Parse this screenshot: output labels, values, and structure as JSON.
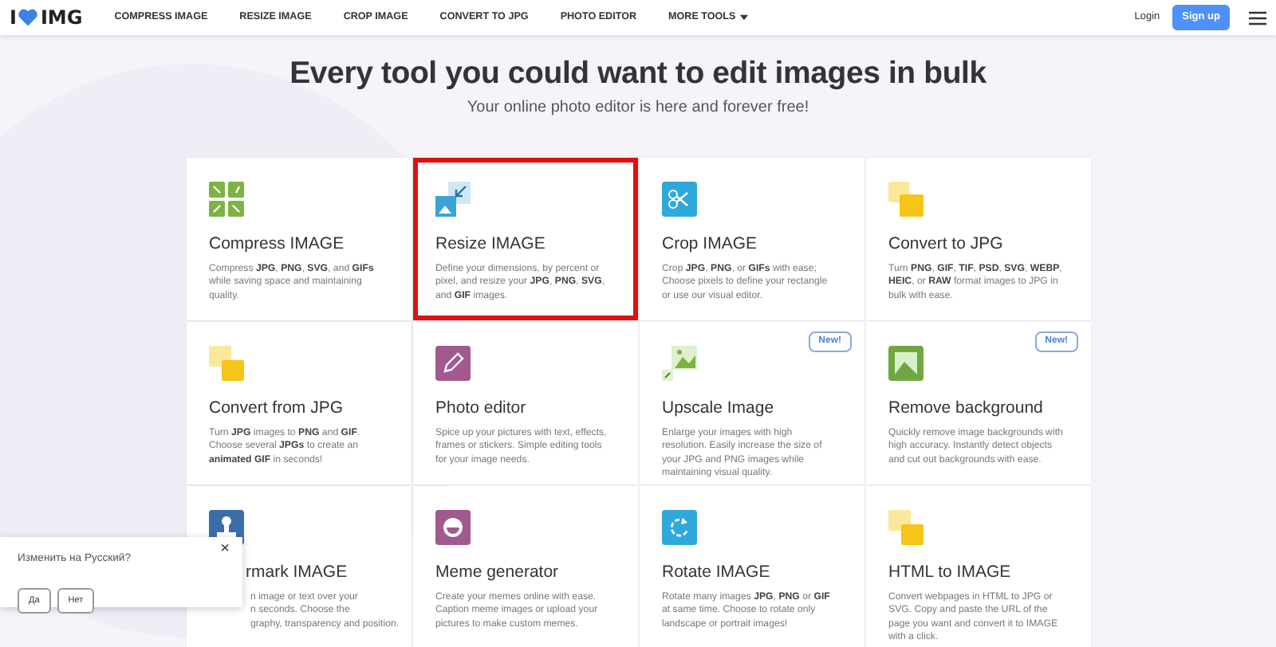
{
  "nav": {
    "logo": {
      "left": "I",
      "right": "IMG"
    },
    "links": [
      {
        "label": "COMPRESS IMAGE",
        "kind": "link"
      },
      {
        "label": "RESIZE IMAGE",
        "kind": "link"
      },
      {
        "label": "CROP IMAGE",
        "kind": "link"
      },
      {
        "label": "CONVERT TO JPG",
        "kind": "link"
      },
      {
        "label": "PHOTO EDITOR",
        "kind": "link"
      },
      {
        "label": "MORE TOOLS",
        "kind": "dropdown"
      }
    ],
    "login": "Login",
    "signup": "Sign up"
  },
  "hero": {
    "title": "Every tool you could want to edit images in bulk",
    "subtitle": "Your online photo editor is here and forever free!"
  },
  "tools": [
    {
      "title": "Compress IMAGE",
      "description": "Compress **JPG**, **PNG**, **SVG**, and **GIFs** while saving space and maintaining quality.",
      "selected": false
    },
    {
      "title": "Resize IMAGE",
      "description": "Define your dimensions, by percent or pixel, and resize your **JPG**, **PNG**, **SVG**, and **GIF** images.",
      "selected": true
    },
    {
      "title": "Crop IMAGE",
      "description": "Crop **JPG**, **PNG**, or **GIFs** with ease; Choose pixels to define your rectangle or use our visual editor.",
      "selected": false
    },
    {
      "title": "Convert to JPG",
      "description": "Turn **PNG**, **GIF**, **TIF**, **PSD**, **SVG**, **WEBP**, **HEIC**, or **RAW** format images to JPG in bulk with ease.",
      "selected": false
    },
    {
      "title": "Convert from JPG",
      "description": "Turn **JPG** images to **PNG** and **GIF**. Choose several **JPGs** to create an **animated GIF** in seconds!",
      "selected": false
    },
    {
      "title": "Photo editor",
      "description": "Spice up your pictures with text, effects, frames or stickers. Simple editing tools for your image needs.",
      "selected": false
    },
    {
      "title": "Upscale Image",
      "description": "Enlarge your images with high resolution. Easily increase the size of your JPG and PNG images while maintaining visual quality.",
      "selected": false,
      "badge": "New!"
    },
    {
      "title": "Remove background",
      "description": "Quickly remove image backgrounds with high accuracy. Instantly detect objects and cut out backgrounds with ease.",
      "selected": false,
      "badge": "New!"
    },
    {
      "title": "rmark IMAGE",
      "description_lines": [
        "n image or text over your",
        "n seconds. Choose the",
        "graphy, transparency and position."
      ],
      "selected": false,
      "kind": "covered"
    },
    {
      "title": "Meme generator",
      "description": "Create your memes online with ease. Caption meme images or upload your pictures to make custom memes.",
      "selected": false
    },
    {
      "title": "Rotate IMAGE",
      "description": "Rotate many images **JPG**, **PNG** or **GIF** at same time. Choose to rotate only landscape or portrait images!",
      "selected": false
    },
    {
      "title": "HTML to IMAGE",
      "description": "Convert webpages in HTML to JPG or SVG. Copy and paste the URL of the page you want and convert it to IMAGE with a click.",
      "selected": false
    }
  ],
  "language_popup": {
    "question": "Изменить на Русский?",
    "buttons": [
      "Да",
      "Нет"
    ],
    "close": "×"
  }
}
